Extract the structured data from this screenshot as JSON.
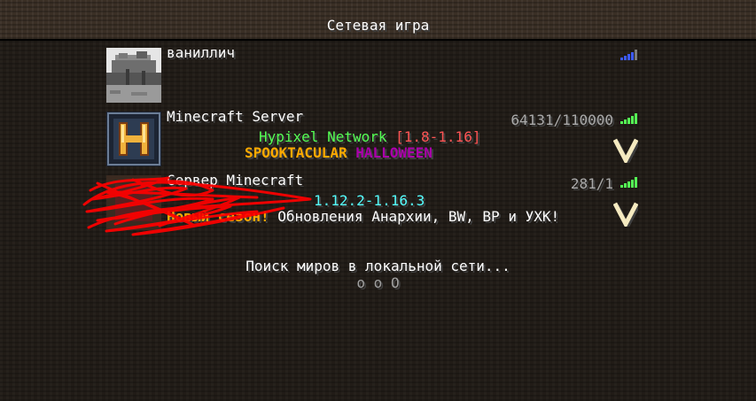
{
  "screen": {
    "title": "Сетевая игра"
  },
  "servers": [
    {
      "name": "ваниллич",
      "players": "",
      "motd_line1": [],
      "motd_line2": []
    },
    {
      "name": "Minecraft Server",
      "players": "64131/110000",
      "motd_line1": [
        {
          "text": "Hypixel Network ",
          "color": "#55ff55",
          "bold": false
        },
        {
          "text": "[1.8-1.16]",
          "color": "#ff5555",
          "bold": false
        }
      ],
      "motd_line2": [
        {
          "text": "SPOOKTACULAR ",
          "color": "#ffaa00",
          "bold": true
        },
        {
          "text": "HALLOWEEN",
          "color": "#aa00aa",
          "bold": true
        }
      ]
    },
    {
      "name": "Сервер Minecraft",
      "players": "281/1",
      "motd_line1": [
        {
          "text": "1.12.2-1.16.3",
          "color": "#55ffff",
          "bold": false
        }
      ],
      "motd_line2": [
        {
          "text": "Новый сезон! ",
          "color": "#ffaa00",
          "bold": true
        },
        {
          "text": "Обновления Анархии, BW, BP и УХК!",
          "color": "#ffffff",
          "bold": false
        }
      ]
    }
  ],
  "lan": {
    "scan_text": "Поиск миров в локальной сети...",
    "scan_dots": "o o O"
  },
  "colors": {
    "signal_active": "#55ff55",
    "signal_pinging": "#3c5aff",
    "chevron": "#f5eac0",
    "scribble": "#ff0000"
  }
}
